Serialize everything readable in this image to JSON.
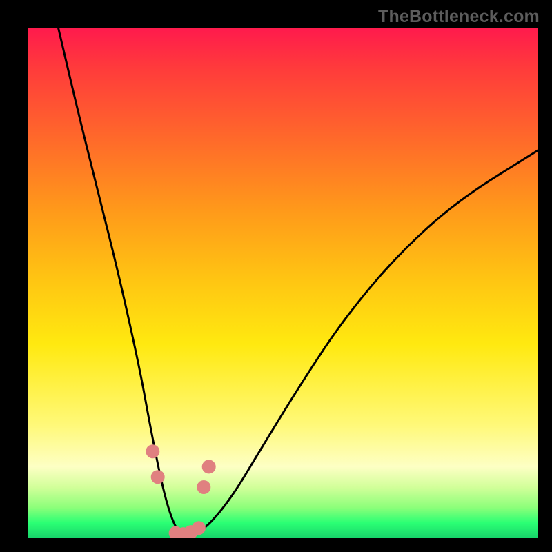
{
  "watermark": "TheBottleneck.com",
  "chart_data": {
    "type": "line",
    "title": "",
    "xlabel": "",
    "ylabel": "",
    "xlim": [
      0,
      100
    ],
    "ylim": [
      0,
      100
    ],
    "series": [
      {
        "name": "bottleneck-curve",
        "x": [
          6,
          10,
          14,
          18,
          22,
          24,
          26,
          27.5,
          29,
          30.5,
          32,
          35,
          40,
          46,
          54,
          62,
          72,
          84,
          100
        ],
        "y": [
          100,
          83,
          67,
          51,
          33,
          22,
          12,
          6,
          2,
          0.5,
          0.5,
          2,
          8,
          18,
          31,
          43,
          55,
          66,
          76
        ]
      }
    ],
    "markers": {
      "name": "highlighted-points",
      "color": "#e08080",
      "points": [
        {
          "x": 24.5,
          "y": 17
        },
        {
          "x": 25.5,
          "y": 12
        },
        {
          "x": 29.0,
          "y": 1.0
        },
        {
          "x": 30.5,
          "y": 0.8
        },
        {
          "x": 32.0,
          "y": 1.2
        },
        {
          "x": 33.5,
          "y": 2.0
        },
        {
          "x": 34.5,
          "y": 10
        },
        {
          "x": 35.5,
          "y": 14
        }
      ]
    },
    "background_gradient": {
      "top": "#ff1a4d",
      "mid": "#ffe910",
      "bottom": "#17d36a"
    }
  }
}
